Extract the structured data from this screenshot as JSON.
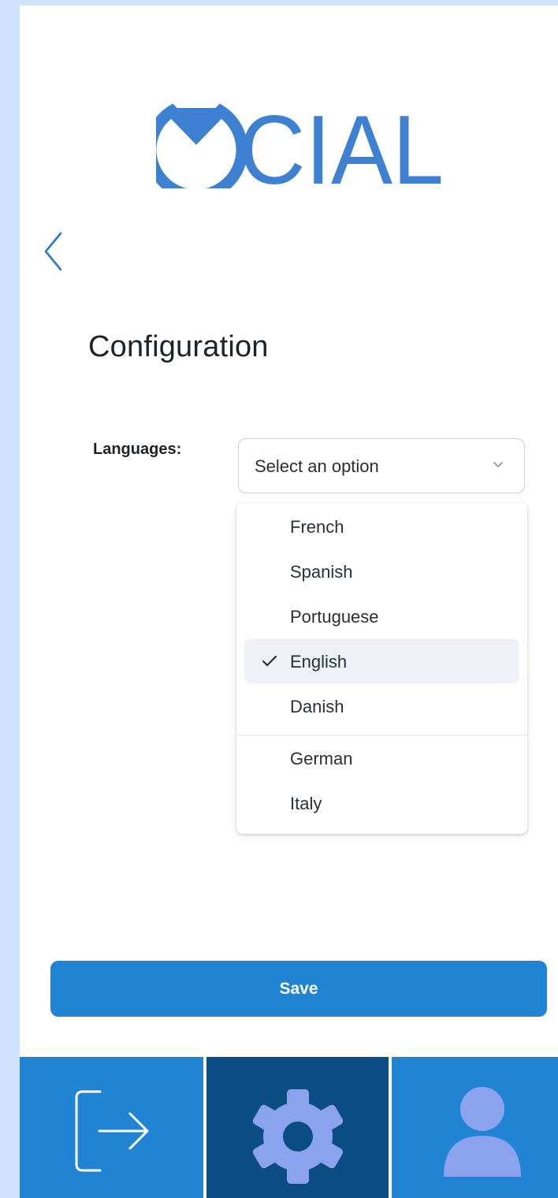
{
  "app": {
    "logo_text": "OCIAL",
    "brand_color": "#3e81d2"
  },
  "page": {
    "title": "Configuration"
  },
  "languages": {
    "label": "Languages:",
    "placeholder": "Select an option",
    "options": [
      {
        "label": "French",
        "selected": false
      },
      {
        "label": "Spanish",
        "selected": false
      },
      {
        "label": "Portuguese",
        "selected": false
      },
      {
        "label": "English",
        "selected": true
      },
      {
        "label": "Danish",
        "selected": false
      },
      {
        "label": "German",
        "selected": false
      },
      {
        "label": "Italy",
        "selected": false
      }
    ]
  },
  "actions": {
    "save_label": "Save",
    "save_color": "#2183d3"
  },
  "nav": {
    "tabs": [
      {
        "name": "logout",
        "icon": "logout-icon",
        "active": false
      },
      {
        "name": "settings",
        "icon": "gear-icon",
        "active": true
      },
      {
        "name": "profile",
        "icon": "user-icon",
        "active": false
      }
    ],
    "tab_color": "#2183d3",
    "active_tab_color": "#0a4c84",
    "icon_color": "#8ba2ee"
  }
}
